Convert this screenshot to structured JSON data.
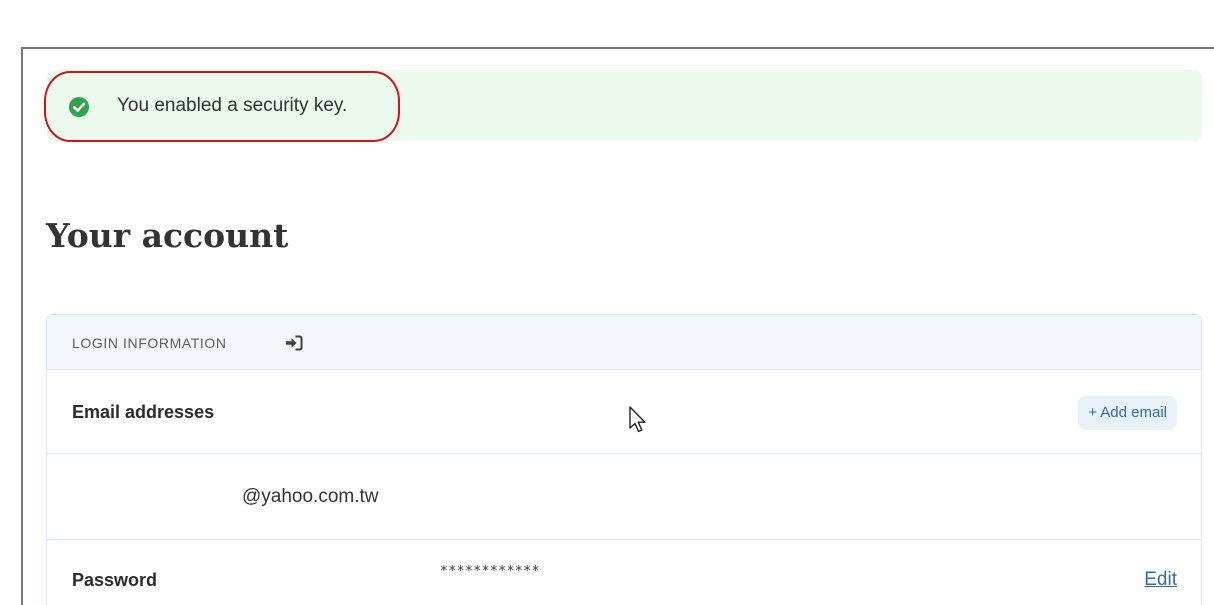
{
  "alert": {
    "icon": "check-circle-icon",
    "message": "You enabled a security key.",
    "background_color": "#ebfaed",
    "icon_color": "#2ea44f"
  },
  "annotation": {
    "color": "#d0161b"
  },
  "page": {
    "title": "Your account"
  },
  "login_card": {
    "header_label": "LOGIN INFORMATION",
    "header_icon": "sign-in-icon",
    "email_section": {
      "label": "Email addresses",
      "add_button_label": "+ Add email",
      "emails": [
        "@yahoo.com.tw"
      ]
    },
    "password_section": {
      "label": "Password",
      "masked_value": "************",
      "edit_label": "Edit"
    }
  },
  "colors": {
    "link": "#2f6fa8",
    "card_header_bg": "#f3f7fc"
  }
}
